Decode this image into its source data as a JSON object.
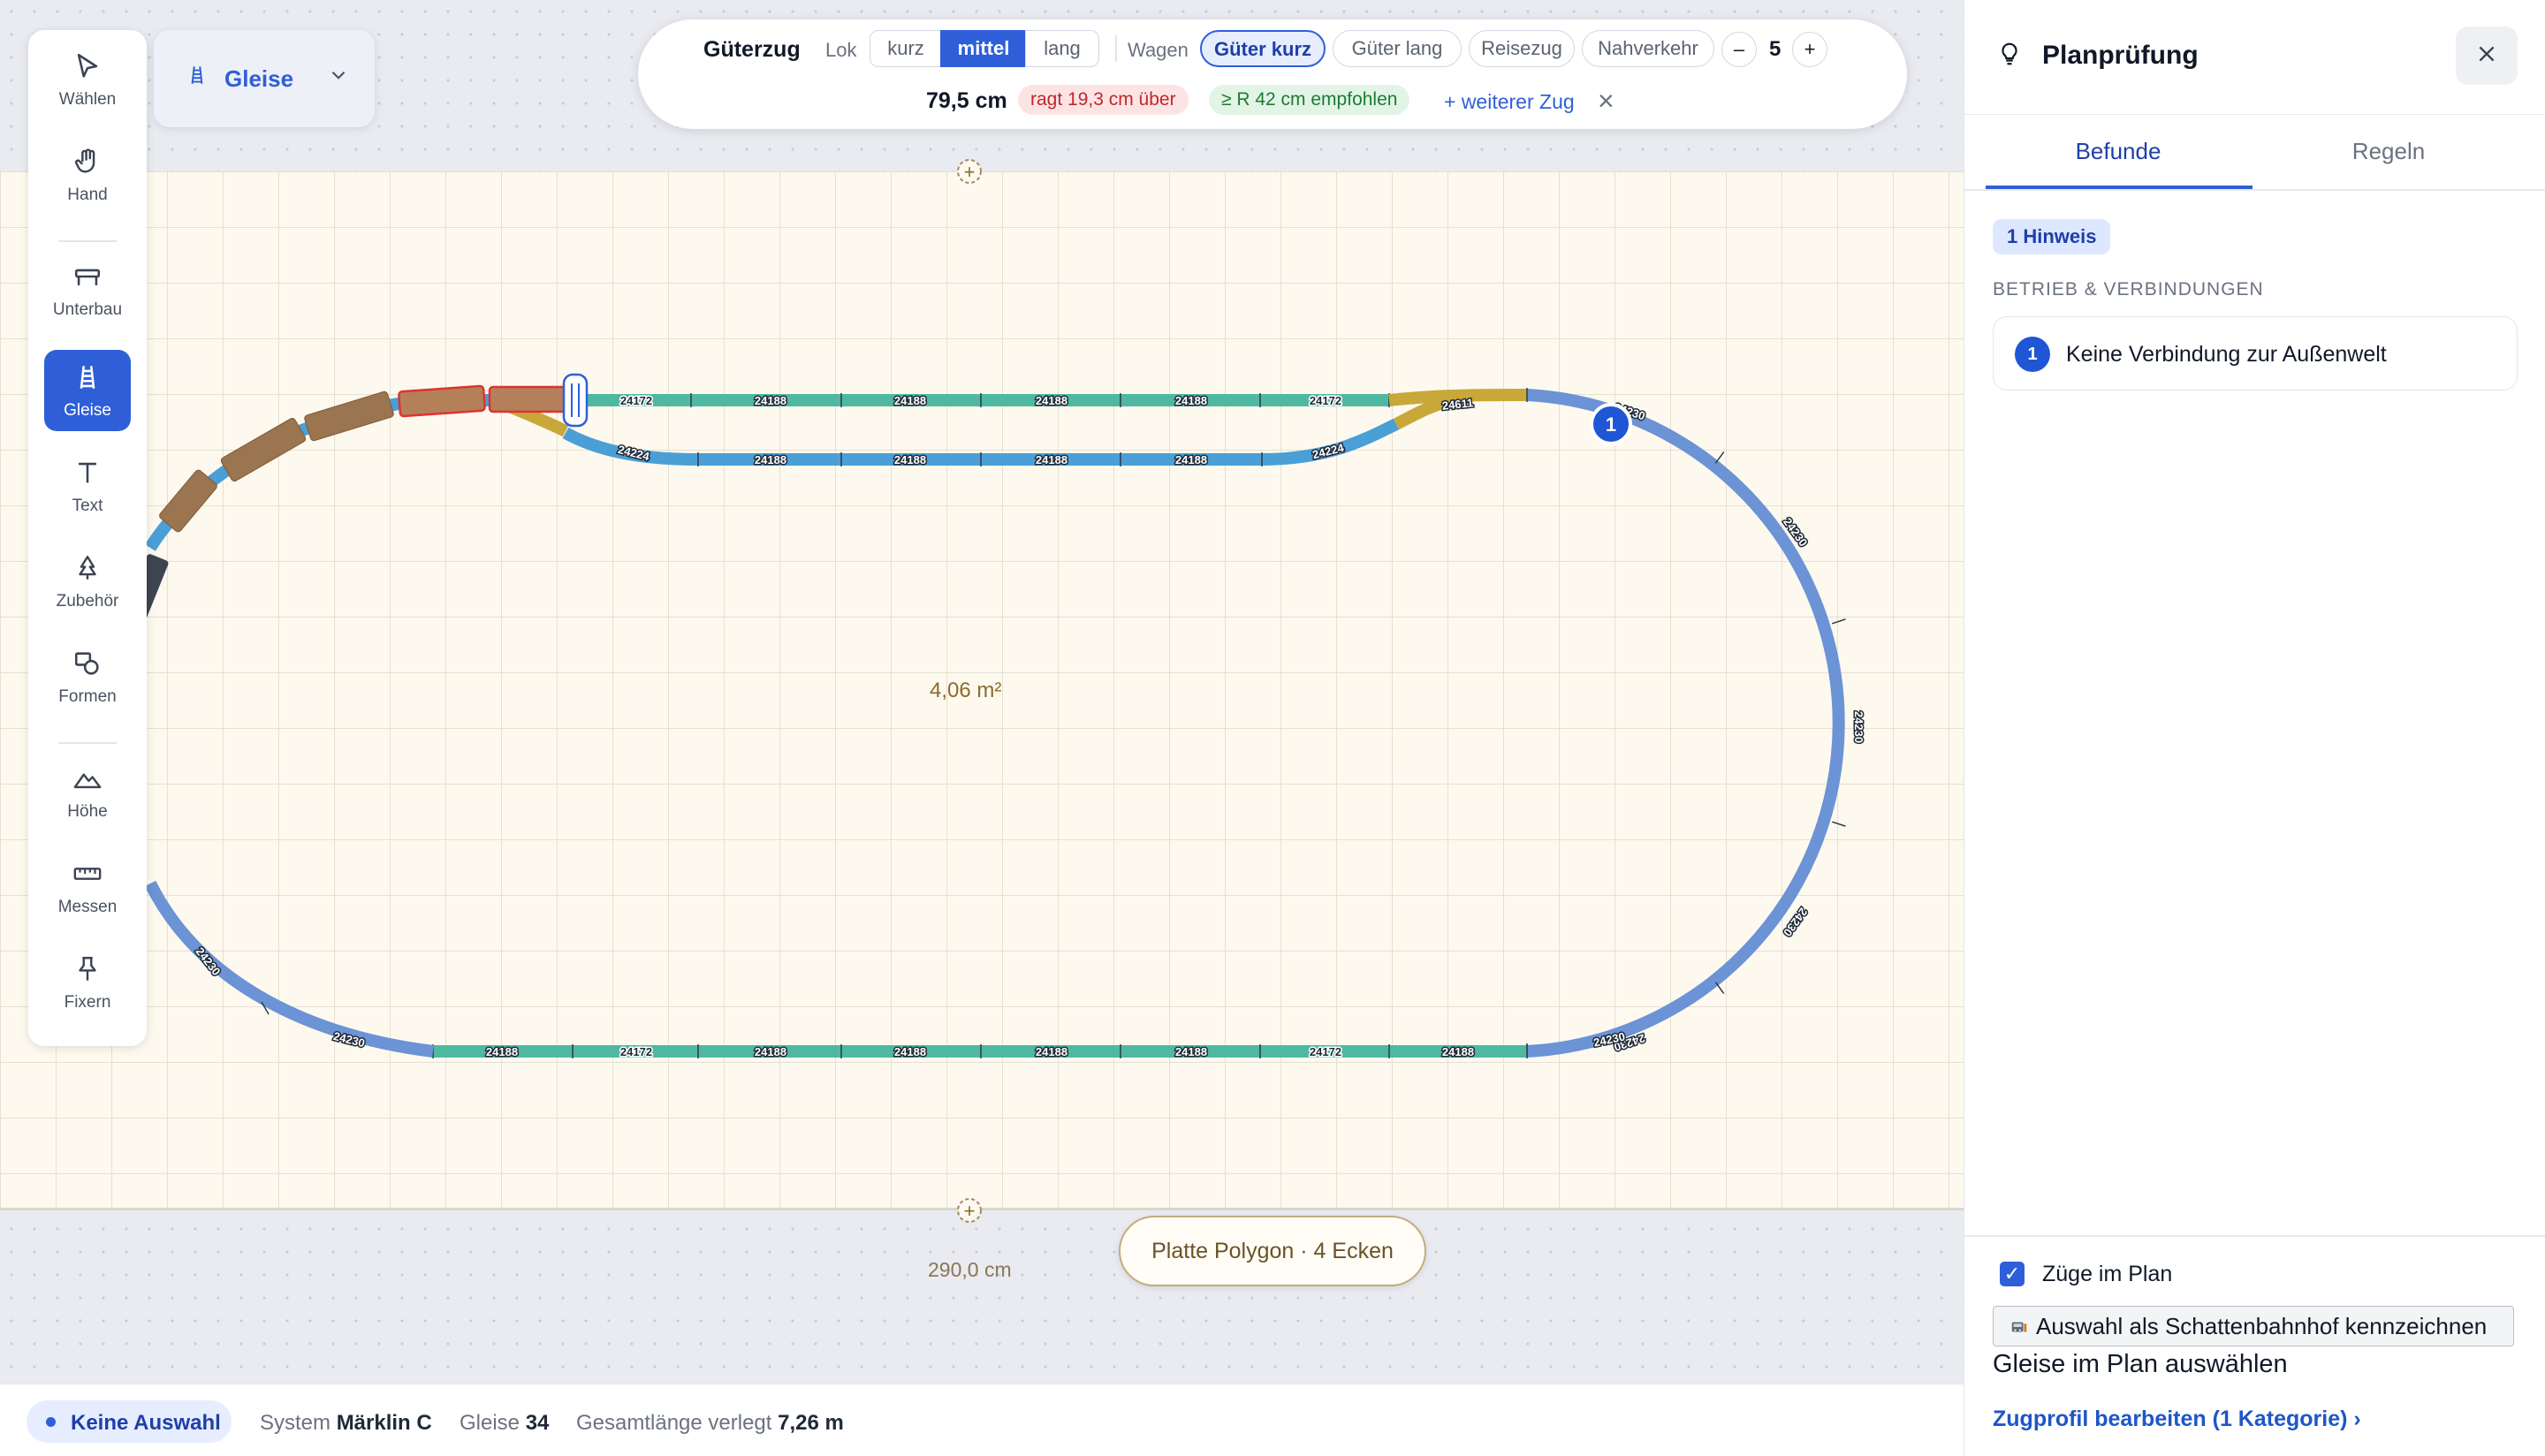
{
  "toolbar": {
    "tools": [
      {
        "label": "Wählen",
        "icon": "cursor-icon"
      },
      {
        "label": "Hand",
        "icon": "hand-icon"
      },
      {
        "label": "Unterbau",
        "icon": "table-icon"
      },
      {
        "label": "Gleise",
        "icon": "track-icon"
      },
      {
        "label": "Text",
        "icon": "text-icon"
      },
      {
        "label": "Zubehör",
        "icon": "tree-icon"
      },
      {
        "label": "Formen",
        "icon": "shapes-icon"
      },
      {
        "label": "Höhe",
        "icon": "mountain-icon"
      },
      {
        "label": "Messen",
        "icon": "ruler-icon"
      },
      {
        "label": "Fixern",
        "icon": "pin-icon"
      }
    ],
    "active": "Gleise"
  },
  "layer_dropdown": {
    "label": "Gleise"
  },
  "train_bar": {
    "name": "Güterzug",
    "lok_label": "Lok",
    "lok_options": [
      "kurz",
      "mittel",
      "lang"
    ],
    "lok_selected": "mittel",
    "wagen_label": "Wagen",
    "wagen_options": [
      "Güter kurz",
      "Güter lang",
      "Reisezug",
      "Nahverkehr"
    ],
    "wagen_selected": "Güter kurz",
    "minus": "–",
    "count": "5",
    "plus": "+",
    "length": "79,5 cm",
    "overhang": "ragt 19,3 cm über",
    "recommend": "≥ R 42 cm empfohlen",
    "add_train": "+ weiterer Zug",
    "remove_icon": "×"
  },
  "plan": {
    "area": "4,06 m²",
    "width_dim": "290,0 cm",
    "plate_pill": "Platte Polygon · 4 Ecken",
    "marker_number": "1",
    "track_labels": {
      "top": [
        "24172",
        "24188",
        "24188",
        "24188",
        "24188",
        "24172"
      ],
      "top_switch": "24611",
      "inner": [
        "24224",
        "24188",
        "24188",
        "24188",
        "24188",
        "24224"
      ],
      "bottom": [
        "24188",
        "24172",
        "24188",
        "24188",
        "24188",
        "24188",
        "24172",
        "24188"
      ],
      "curve_right": [
        "24230",
        "24230",
        "24230",
        "24230",
        "24230"
      ],
      "curve_left": [
        "24230",
        "24230"
      ]
    }
  },
  "status_bar": {
    "selection": "Keine Auswahl",
    "system_label": "System",
    "system_value": "Märklin C",
    "tracks_label": "Gleise",
    "tracks_value": "34",
    "length_label": "Gesamtlänge verlegt",
    "length_value": "7,26 m"
  },
  "panel": {
    "title": "Planprüfung",
    "tabs": [
      "Befunde",
      "Regeln"
    ],
    "active_tab": "Befunde",
    "hint_badge": "1 Hinweis",
    "category": "BETRIEB & VERBINDUNGEN",
    "findings": [
      {
        "number": "1",
        "text": "Keine Verbindung zur Außenwelt"
      }
    ],
    "trains_checkbox_label": "Züge im Plan",
    "trains_checked": true,
    "shadow_button": "Auswahl als Schattenbahnhof kennzeichnen",
    "select_tracks_text": "Gleise im Plan auswählen",
    "profile_link": "Zugprofil bearbeiten (1 Kategorie) ›"
  },
  "colors": {
    "accent": "#2f5fd8",
    "straight_track": "#4fb8a0",
    "curve_track": "#6b93d6",
    "inner_track": "#4a9fd6",
    "switch_track": "#c9a83a",
    "plate": "#fdf9ee",
    "wagon": "#9b7450",
    "overhang_wagon_border": "#e03131"
  }
}
